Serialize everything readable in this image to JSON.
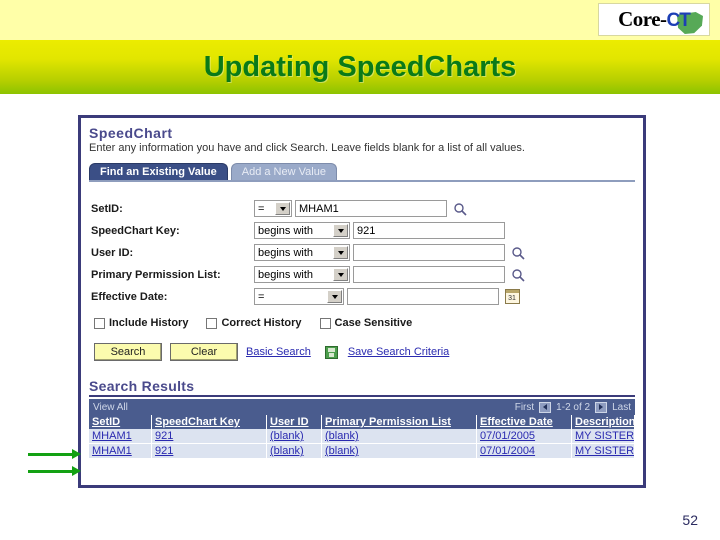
{
  "header": {
    "logo": {
      "text_main": "Core-",
      "text_accent": "CT",
      "state_shape": "connecticut-outline"
    },
    "title": "Updating SpeedCharts"
  },
  "panel": {
    "heading": "SpeedChart",
    "instructions": "Enter any information you have and click Search. Leave fields blank for a list of all values.",
    "tabs": [
      {
        "label": "Find an Existing Value",
        "active": true
      },
      {
        "label": "Add a New Value",
        "active": false
      }
    ],
    "fields": [
      {
        "label": "SetID:",
        "operator": "=",
        "value": "MHAM1",
        "icon": "lookup-magnifier-icon"
      },
      {
        "label": "SpeedChart Key:",
        "operator": "begins with",
        "value": "921",
        "icon": ""
      },
      {
        "label": "User ID:",
        "operator": "begins with",
        "value": "",
        "icon": "lookup-magnifier-icon"
      },
      {
        "label": "Primary Permission List:",
        "operator": "begins with",
        "value": "",
        "icon": "lookup-magnifier-icon"
      },
      {
        "label": "Effective Date:",
        "operator": "=",
        "value": "",
        "icon": "calendar-icon",
        "calendar_glyph": "31"
      }
    ],
    "checkboxes": [
      {
        "label": "Include History",
        "checked": false
      },
      {
        "label": "Correct History",
        "checked": false
      },
      {
        "label": "Case Sensitive",
        "checked": false
      }
    ],
    "actions": {
      "search_label": "Search",
      "clear_label": "Clear",
      "basic_search_label": "Basic Search",
      "save_criteria_label": "Save Search Criteria",
      "save_icon": "save-disk-icon"
    },
    "results": {
      "heading": "Search Results",
      "view_all_label": "View All",
      "pager": {
        "first_label": "First",
        "range_label": "1-2 of 2",
        "last_label": "Last",
        "prev_icon": "arrow-left-icon",
        "next_icon": "arrow-right-icon"
      },
      "columns": [
        "SetID",
        "SpeedChart Key",
        "User ID",
        "Primary Permission List",
        "Effective Date",
        "Description"
      ],
      "rows": [
        {
          "setid": "MHAM1",
          "key": "921",
          "user_id": "(blank)",
          "permission_list": "(blank)",
          "effective_date": "07/01/2005",
          "description": "MY SISTER'S PLACE"
        },
        {
          "setid": "MHAM1",
          "key": "921",
          "user_id": "(blank)",
          "permission_list": "(blank)",
          "effective_date": "07/01/2004",
          "description": "MY SISTER'S PLACE"
        }
      ]
    }
  },
  "annotations": {
    "arrows": [
      "green-arrow-row-1",
      "green-arrow-row-2"
    ]
  },
  "slide": {
    "page_number": "52"
  },
  "colors": {
    "banner_yellow": "#ffffa8",
    "title_green": "#0a7a18",
    "panel_border": "#3b3b7a",
    "ps_heading_blue": "#4a4a8c",
    "results_header_blue": "#4a5c8e",
    "row_blue": "#dce3f0",
    "link_blue": "#2a2ab0",
    "button_yellow": "#fbfbae",
    "arrow_green": "#13a113"
  }
}
